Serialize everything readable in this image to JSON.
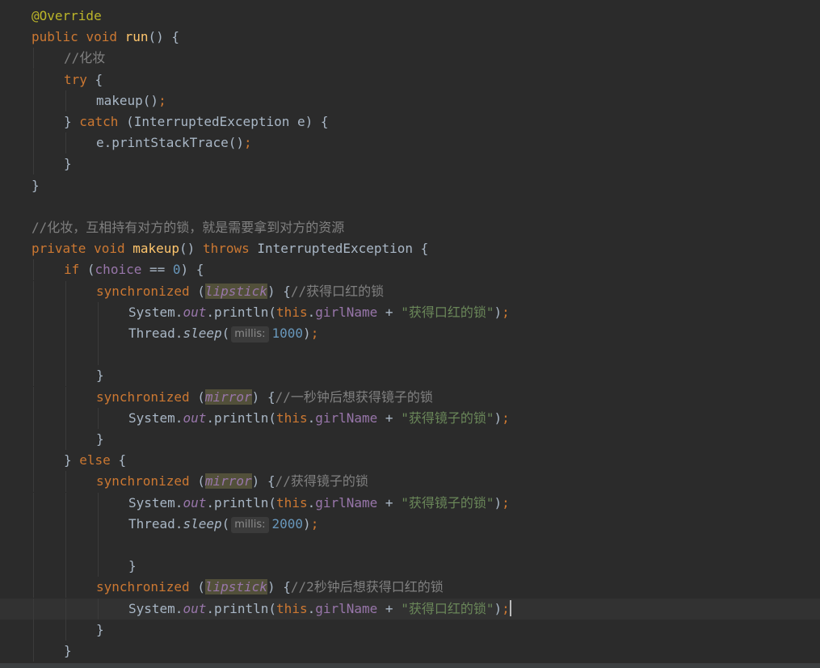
{
  "editor": {
    "lines": [
      {
        "indent": 0,
        "tokens": [
          {
            "t": "@Override",
            "c": "ann"
          }
        ]
      },
      {
        "indent": 0,
        "tokens": [
          {
            "t": "public ",
            "c": "kw"
          },
          {
            "t": "void ",
            "c": "kw"
          },
          {
            "t": "run",
            "c": "mth"
          },
          {
            "t": "() {"
          }
        ]
      },
      {
        "indent": 1,
        "tokens": [
          {
            "t": "//化妆",
            "c": "cm"
          }
        ]
      },
      {
        "indent": 1,
        "tokens": [
          {
            "t": "try ",
            "c": "kw"
          },
          {
            "t": "{"
          }
        ]
      },
      {
        "indent": 2,
        "tokens": [
          {
            "t": "makeup()"
          },
          {
            "t": ";",
            "c": "kw"
          }
        ]
      },
      {
        "indent": 1,
        "tokens": [
          {
            "t": "} "
          },
          {
            "t": "catch ",
            "c": "kw"
          },
          {
            "t": "(InterruptedException e) {"
          }
        ]
      },
      {
        "indent": 2,
        "tokens": [
          {
            "t": "e.printStackTrace()"
          },
          {
            "t": ";",
            "c": "kw"
          }
        ]
      },
      {
        "indent": 1,
        "tokens": [
          {
            "t": "}"
          }
        ]
      },
      {
        "indent": 0,
        "tokens": [
          {
            "t": "}"
          }
        ]
      },
      {
        "indent": 0,
        "tokens": []
      },
      {
        "indent": 0,
        "tokens": [
          {
            "t": "//化妆，互相持有对方的锁，就是需要拿到对方的资源",
            "c": "cm"
          }
        ]
      },
      {
        "indent": 0,
        "tokens": [
          {
            "t": "private ",
            "c": "kw"
          },
          {
            "t": "void ",
            "c": "kw"
          },
          {
            "t": "makeup",
            "c": "mth"
          },
          {
            "t": "() "
          },
          {
            "t": "throws ",
            "c": "kw"
          },
          {
            "t": "InterruptedException {"
          }
        ]
      },
      {
        "indent": 1,
        "tokens": [
          {
            "t": "if ",
            "c": "kw"
          },
          {
            "t": "("
          },
          {
            "t": "choice",
            "c": "fld"
          },
          {
            "t": " == "
          },
          {
            "t": "0",
            "c": "num"
          },
          {
            "t": ") {"
          }
        ]
      },
      {
        "indent": 2,
        "tokens": [
          {
            "t": "synchronized ",
            "c": "kw"
          },
          {
            "t": "("
          },
          {
            "t": "lipstick",
            "c": "ifld hl"
          },
          {
            "t": ") {"
          },
          {
            "t": "//获得口红的锁",
            "c": "cm"
          }
        ]
      },
      {
        "indent": 3,
        "tokens": [
          {
            "t": "System."
          },
          {
            "t": "out",
            "c": "ifld"
          },
          {
            "t": ".println("
          },
          {
            "t": "this",
            "c": "kw"
          },
          {
            "t": "."
          },
          {
            "t": "girlName",
            "c": "fld"
          },
          {
            "t": " + "
          },
          {
            "t": "\"获得口红的锁\"",
            "c": "str"
          },
          {
            "t": ")"
          },
          {
            "t": ";",
            "c": "kw"
          }
        ]
      },
      {
        "indent": 3,
        "tokens": [
          {
            "t": "Thread."
          },
          {
            "t": "sleep",
            "c": "sfn"
          },
          {
            "t": "("
          },
          {
            "t": "millis:",
            "c": "hint"
          },
          {
            "t": "1000",
            "c": "num"
          },
          {
            "t": ")"
          },
          {
            "t": ";",
            "c": "kw"
          }
        ]
      },
      {
        "indent": 3,
        "tokens": []
      },
      {
        "indent": 2,
        "tokens": [
          {
            "t": "}"
          }
        ]
      },
      {
        "indent": 2,
        "tokens": [
          {
            "t": "synchronized ",
            "c": "kw"
          },
          {
            "t": "("
          },
          {
            "t": "mirror",
            "c": "ifld hl"
          },
          {
            "t": ") {"
          },
          {
            "t": "//一秒钟后想获得镜子的锁",
            "c": "cm"
          }
        ]
      },
      {
        "indent": 3,
        "tokens": [
          {
            "t": "System."
          },
          {
            "t": "out",
            "c": "ifld"
          },
          {
            "t": ".println("
          },
          {
            "t": "this",
            "c": "kw"
          },
          {
            "t": "."
          },
          {
            "t": "girlName",
            "c": "fld"
          },
          {
            "t": " + "
          },
          {
            "t": "\"获得镜子的锁\"",
            "c": "str"
          },
          {
            "t": ")"
          },
          {
            "t": ";",
            "c": "kw"
          }
        ]
      },
      {
        "indent": 2,
        "tokens": [
          {
            "t": "}"
          }
        ]
      },
      {
        "indent": 1,
        "tokens": [
          {
            "t": "} "
          },
          {
            "t": "else ",
            "c": "kw"
          },
          {
            "t": "{"
          }
        ]
      },
      {
        "indent": 2,
        "tokens": [
          {
            "t": "synchronized ",
            "c": "kw"
          },
          {
            "t": "("
          },
          {
            "t": "mirror",
            "c": "ifld hl"
          },
          {
            "t": ") {"
          },
          {
            "t": "//获得镜子的锁",
            "c": "cm"
          }
        ]
      },
      {
        "indent": 3,
        "tokens": [
          {
            "t": "System."
          },
          {
            "t": "out",
            "c": "ifld"
          },
          {
            "t": ".println("
          },
          {
            "t": "this",
            "c": "kw"
          },
          {
            "t": "."
          },
          {
            "t": "girlName",
            "c": "fld"
          },
          {
            "t": " + "
          },
          {
            "t": "\"获得镜子的锁\"",
            "c": "str"
          },
          {
            "t": ")"
          },
          {
            "t": ";",
            "c": "kw"
          }
        ]
      },
      {
        "indent": 3,
        "tokens": [
          {
            "t": "Thread."
          },
          {
            "t": "sleep",
            "c": "sfn"
          },
          {
            "t": "("
          },
          {
            "t": "millis:",
            "c": "hint"
          },
          {
            "t": "2000",
            "c": "num"
          },
          {
            "t": ")"
          },
          {
            "t": ";",
            "c": "kw"
          }
        ]
      },
      {
        "indent": 3,
        "tokens": []
      },
      {
        "indent": 3,
        "tokens": [
          {
            "t": "}"
          }
        ]
      },
      {
        "indent": 2,
        "tokens": [
          {
            "t": "synchronized ",
            "c": "kw"
          },
          {
            "t": "("
          },
          {
            "t": "lipstick",
            "c": "ifld hl"
          },
          {
            "t": ") {"
          },
          {
            "t": "//2秒钟后想获得口红的锁",
            "c": "cm"
          }
        ]
      },
      {
        "indent": 3,
        "current": true,
        "caret": true,
        "tokens": [
          {
            "t": "System."
          },
          {
            "t": "out",
            "c": "ifld"
          },
          {
            "t": ".println("
          },
          {
            "t": "this",
            "c": "kw"
          },
          {
            "t": "."
          },
          {
            "t": "girlName",
            "c": "fld"
          },
          {
            "t": " + "
          },
          {
            "t": "\"获得口红的锁\"",
            "c": "str"
          },
          {
            "t": ")"
          },
          {
            "t": ";",
            "c": "kw"
          }
        ]
      },
      {
        "indent": 2,
        "tokens": [
          {
            "t": "}"
          }
        ]
      },
      {
        "indent": 1,
        "tokens": [
          {
            "t": "}"
          }
        ]
      }
    ]
  }
}
